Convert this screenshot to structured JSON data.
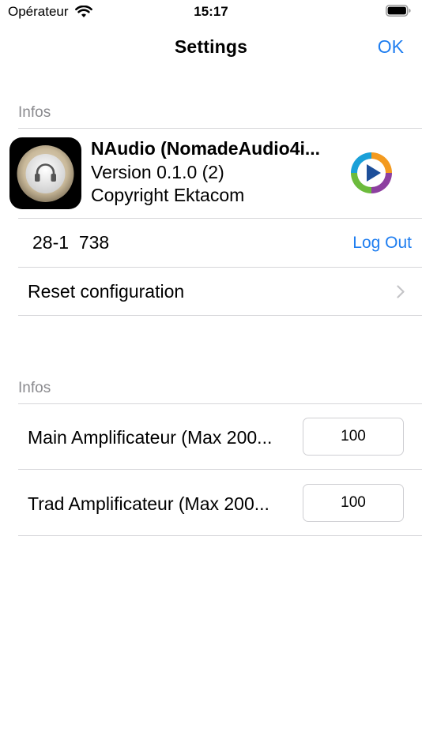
{
  "status_bar": {
    "carrier": "Opérateur",
    "time": "15:17",
    "wifi_icon": "wifi-icon",
    "battery_icon": "battery-full-icon"
  },
  "nav": {
    "title": "Settings",
    "ok_label": "OK"
  },
  "sections": {
    "infos_1": "Infos",
    "infos_2": "Infos"
  },
  "app_info": {
    "name": "NAudio (NomadeAudio4i...",
    "version": "Version 0.1.0 (2)",
    "copyright": "Copyright Ektacom",
    "app_icon": "headphones-icon",
    "brand_logo": "play-logo-icon"
  },
  "account": {
    "id": "28-1  738",
    "logout_label": "Log Out"
  },
  "reset": {
    "label": "Reset configuration",
    "chevron_icon": "chevron-right-icon"
  },
  "amplifiers": {
    "main": {
      "label": "Main Amplificateur (Max 200...",
      "value": "100"
    },
    "trad": {
      "label": "Trad Amplificateur (Max 200...",
      "value": "100"
    }
  },
  "colors": {
    "accent": "#1f7ef0",
    "section_header": "#8a8a8e",
    "separator": "#d6d6d9"
  }
}
